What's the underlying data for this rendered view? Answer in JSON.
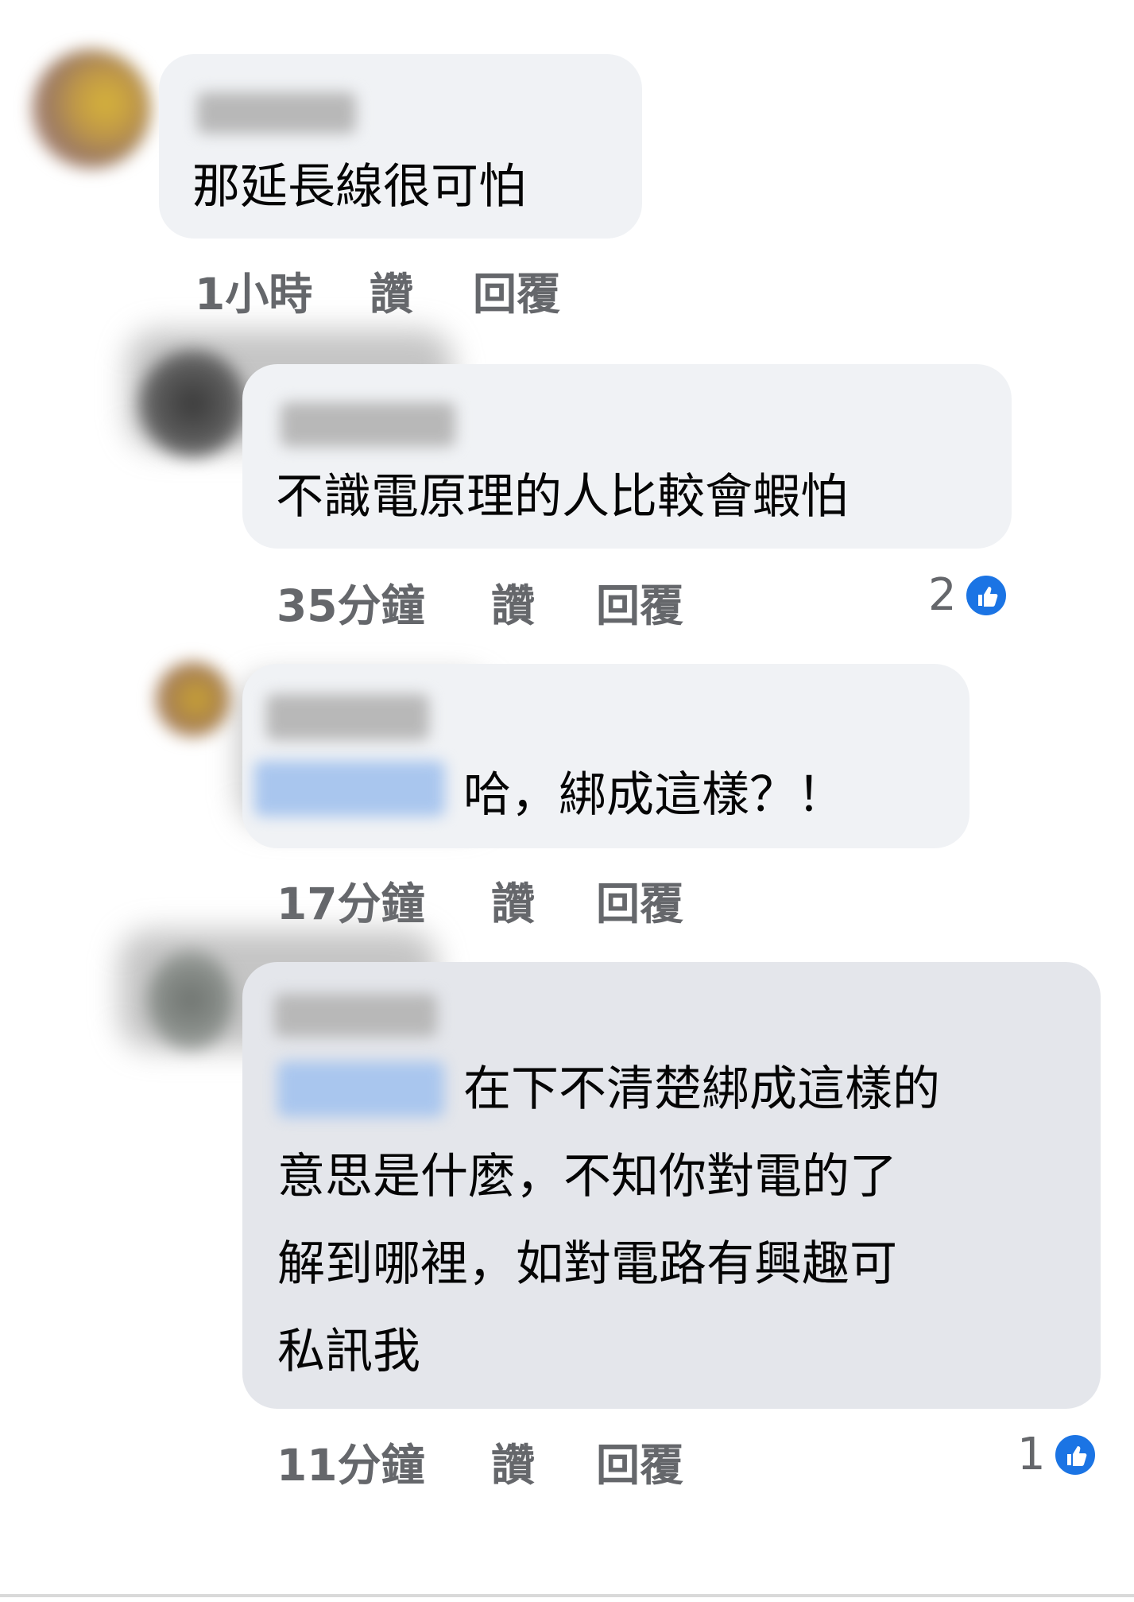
{
  "comments": [
    {
      "text": "那延長線很可怕",
      "time": "1小時",
      "like_label": "讚",
      "reply_label": "回覆"
    },
    {
      "text": "不識電原理的人比較會蝦怕",
      "time": "35分鐘",
      "like_label": "讚",
      "reply_label": "回覆",
      "reaction_count": "2"
    },
    {
      "text": "哈，綁成這樣？！",
      "time": "17分鐘",
      "like_label": "讚",
      "reply_label": "回覆"
    },
    {
      "text_lines": [
        "在下不清楚綁成這樣的",
        "意思是什麼，不知你對電的了",
        "解到哪裡，如對電路有興趣可",
        "私訊我"
      ],
      "time": "11分鐘",
      "like_label": "讚",
      "reply_label": "回覆",
      "reaction_count": "1"
    }
  ],
  "colors": {
    "bubble": "#f0f2f5",
    "bubble_highlighted": "#e4e6eb",
    "meta_text": "#65676b",
    "like_icon": "#1b74e4"
  },
  "icons": [
    "thumbs-up-icon"
  ]
}
